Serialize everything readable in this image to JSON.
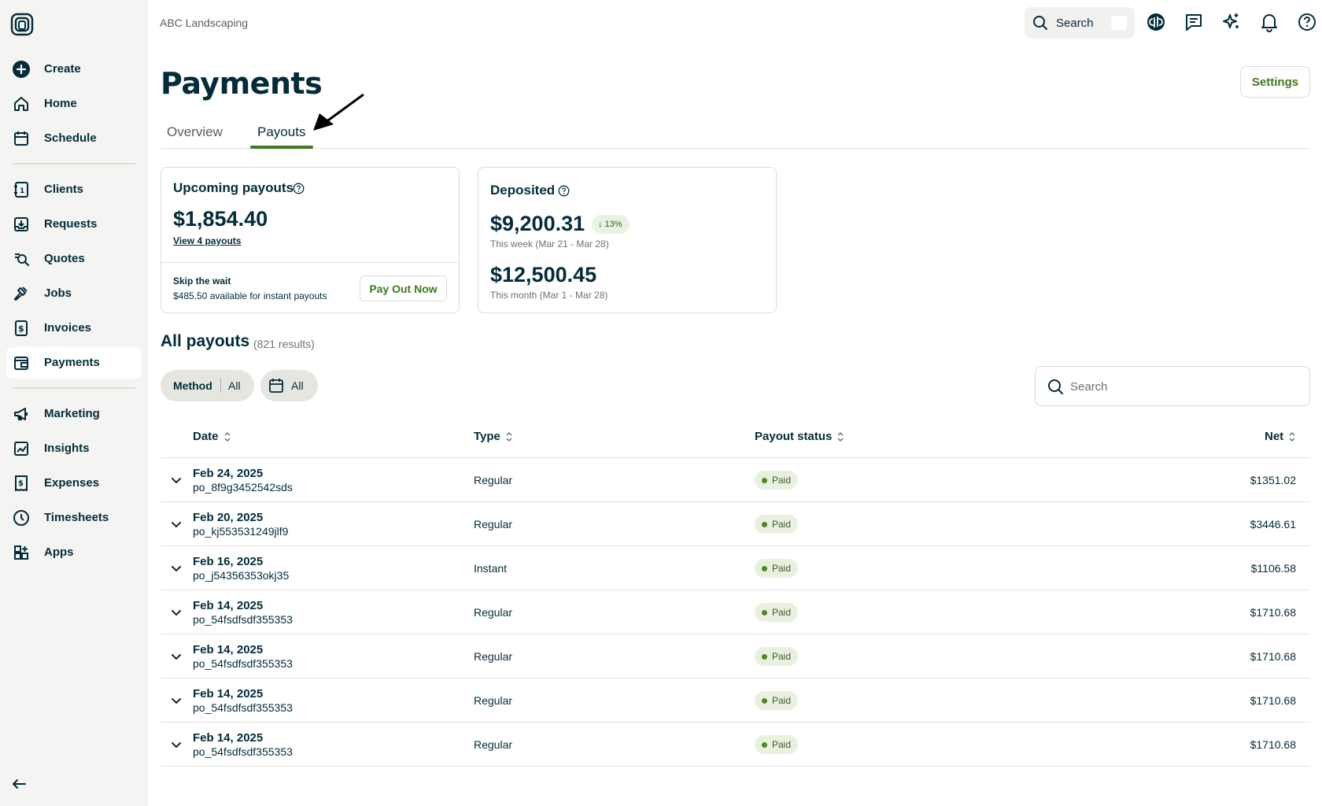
{
  "company": "ABC Landscaping",
  "top_search": {
    "label": "Search"
  },
  "sidebar": {
    "items": [
      {
        "label": "Create",
        "icon": "plus-circle-icon"
      },
      {
        "label": "Home",
        "icon": "home-icon"
      },
      {
        "label": "Schedule",
        "icon": "calendar-icon"
      },
      {
        "label": "Clients",
        "icon": "address-book-icon"
      },
      {
        "label": "Requests",
        "icon": "inbox-download-icon"
      },
      {
        "label": "Quotes",
        "icon": "search-document-icon"
      },
      {
        "label": "Jobs",
        "icon": "hammer-icon"
      },
      {
        "label": "Invoices",
        "icon": "dollar-document-icon"
      },
      {
        "label": "Payments",
        "icon": "wallet-icon",
        "active": true
      },
      {
        "label": "Marketing",
        "icon": "megaphone-icon"
      },
      {
        "label": "Insights",
        "icon": "chart-icon"
      },
      {
        "label": "Expenses",
        "icon": "receipt-icon"
      },
      {
        "label": "Timesheets",
        "icon": "clock-icon"
      },
      {
        "label": "Apps",
        "icon": "apps-grid-icon"
      }
    ]
  },
  "page": {
    "title": "Payments",
    "settings_label": "Settings"
  },
  "tabs": [
    {
      "label": "Overview",
      "active": false
    },
    {
      "label": "Payouts",
      "active": true
    }
  ],
  "upcoming": {
    "title": "Upcoming payouts",
    "amount": "$1,854.40",
    "view_link": "View 4 payouts",
    "skip_title": "Skip the wait",
    "skip_sub": "$485.50 available for instant payouts",
    "pay_out_now": "Pay Out Now"
  },
  "deposited": {
    "title": "Deposited",
    "week_amount": "$9,200.31",
    "week_change": "13%",
    "week_caption": "This week (Mar 21 - Mar 28)",
    "month_amount": "$12,500.45",
    "month_caption": "This month (Mar 1 - Mar 28)"
  },
  "all_payouts": {
    "title": "All payouts",
    "count": "(821 results)",
    "filter_method_label": "Method",
    "filter_method_value": "All",
    "filter_date_value": "All",
    "search_placeholder": "Search"
  },
  "table": {
    "headers": {
      "date": "Date",
      "type": "Type",
      "status": "Payout status",
      "net": "Net"
    },
    "rows": [
      {
        "date": "Feb 24, 2025",
        "id": "po_8f9g3452542sds",
        "type": "Regular",
        "status": "Paid",
        "net": "$1351.02"
      },
      {
        "date": "Feb 20, 2025",
        "id": "po_kj553531249jlf9",
        "type": "Regular",
        "status": "Paid",
        "net": "$3446.61"
      },
      {
        "date": "Feb 16, 2025",
        "id": "po_j54356353okj35",
        "type": "Instant",
        "status": "Paid",
        "net": "$1106.58"
      },
      {
        "date": "Feb 14, 2025",
        "id": "po_54fsdfsdf355353",
        "type": "Regular",
        "status": "Paid",
        "net": "$1710.68"
      },
      {
        "date": "Feb 14, 2025",
        "id": "po_54fsdfsdf355353",
        "type": "Regular",
        "status": "Paid",
        "net": "$1710.68"
      },
      {
        "date": "Feb 14, 2025",
        "id": "po_54fsdfsdf355353",
        "type": "Regular",
        "status": "Paid",
        "net": "$1710.68"
      },
      {
        "date": "Feb 14, 2025",
        "id": "po_54fsdfsdf355353",
        "type": "Regular",
        "status": "Paid",
        "net": "$1710.68"
      }
    ]
  },
  "colors": {
    "accent": "#3b7a1e",
    "text": "#032b3a",
    "sidebar_bg": "#f4f4f2",
    "paid_dot": "#4a8a22"
  }
}
